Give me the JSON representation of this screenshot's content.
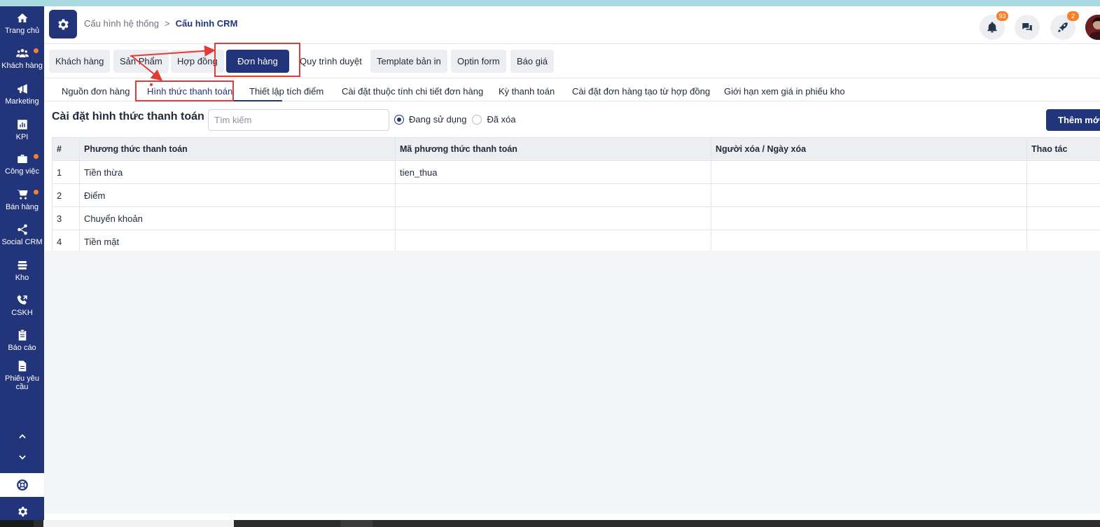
{
  "sidebar": {
    "items": [
      {
        "label": "Trang chủ",
        "icon": "home-icon"
      },
      {
        "label": "Khách hàng",
        "icon": "users-icon"
      },
      {
        "label": "Marketing",
        "icon": "megaphone-icon"
      },
      {
        "label": "KPI",
        "icon": "chart-icon"
      },
      {
        "label": "Công việc",
        "icon": "briefcase-icon"
      },
      {
        "label": "Bán hàng",
        "icon": "cart-icon"
      },
      {
        "label": "Social CRM",
        "icon": "share-icon"
      },
      {
        "label": "Kho",
        "icon": "warehouse-icon"
      },
      {
        "label": "CSKH",
        "icon": "phone-icon"
      },
      {
        "label": "Báo cáo",
        "icon": "clipboard-icon"
      },
      {
        "label": "Phiếu yêu cầu",
        "icon": "document-icon"
      }
    ]
  },
  "header": {
    "breadcrumb_parent": "Cấu hình hệ thống",
    "breadcrumb_separator": ">",
    "breadcrumb_current": "Cấu hình CRM",
    "notification_count": "93",
    "rocket_count": "2"
  },
  "top_tabs": [
    {
      "label": "Khách hàng"
    },
    {
      "label": "Sản Phẩm"
    },
    {
      "label": "Hợp đồng"
    },
    {
      "label": "Đơn hàng"
    },
    {
      "label": "Quy trình duyệt"
    },
    {
      "label": "Template bản in"
    },
    {
      "label": "Optin form"
    },
    {
      "label": "Báo giá"
    }
  ],
  "sub_tabs": [
    {
      "label": "Nguồn đơn hàng"
    },
    {
      "label": "Hình thức thanh toán"
    },
    {
      "label": "Thiết lập tích điểm"
    },
    {
      "label": "Cài đặt thuộc tính chi tiết đơn hàng"
    },
    {
      "label": "Kỳ thanh toán"
    },
    {
      "label": "Cài đặt đơn hàng tạo từ hợp đồng"
    },
    {
      "label": "Giới hạn xem giá in phiếu kho"
    }
  ],
  "toolbar": {
    "title": "Cài đặt hình thức thanh toán",
    "search_placeholder": "Tìm kiếm",
    "radio_active": "Đang sử dụng",
    "radio_deleted": "Đã xóa",
    "add_button": "Thêm mới"
  },
  "table": {
    "headers": [
      "#",
      "Phương thức thanh toán",
      "Mã phương thức thanh toán",
      "Người xóa / Ngày xóa",
      "Thao tác"
    ],
    "rows": [
      [
        "1",
        "Tiền thừa",
        "tien_thua",
        "",
        ""
      ],
      [
        "2",
        "Điểm",
        "",
        "",
        ""
      ],
      [
        "3",
        "Chuyển khoản",
        "",
        "",
        ""
      ],
      [
        "4",
        "Tiền mặt",
        "",
        "",
        ""
      ]
    ]
  },
  "colors": {
    "primary": "#22357a",
    "badge": "#f5802a",
    "annotation": "#e53935"
  }
}
